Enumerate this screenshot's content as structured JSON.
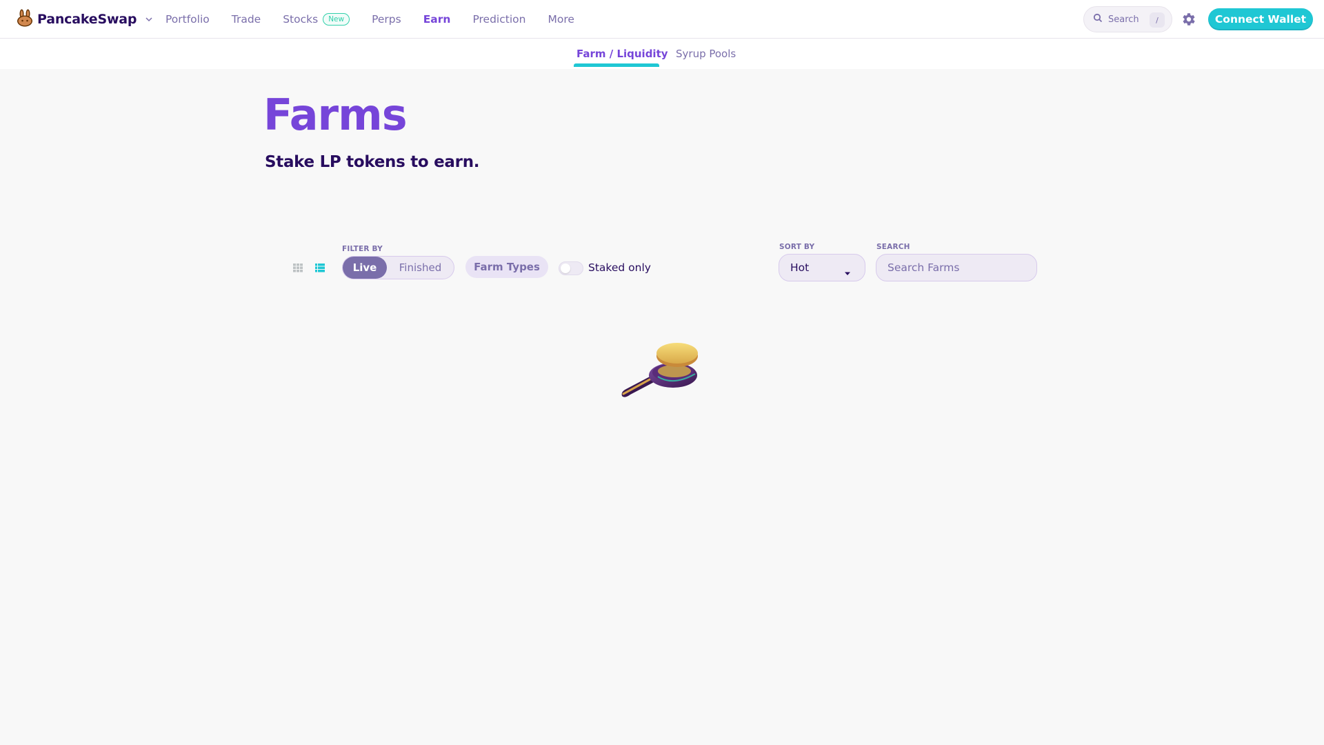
{
  "header": {
    "brand": "PancakeSwap",
    "nav": [
      {
        "label": "Portfolio",
        "active": false
      },
      {
        "label": "Trade",
        "active": false
      },
      {
        "label": "Stocks",
        "badge": "New",
        "active": false
      },
      {
        "label": "Perps",
        "active": false
      },
      {
        "label": "Earn",
        "active": true
      },
      {
        "label": "Prediction",
        "active": false
      },
      {
        "label": "More",
        "active": false
      }
    ],
    "search_label": "Search",
    "search_shortcut": "/",
    "connect_label": "Connect Wallet"
  },
  "subnav": {
    "tabs": [
      {
        "label": "Farm / Liquidity",
        "active": true
      },
      {
        "label": "Syrup Pools",
        "active": false
      }
    ]
  },
  "hero": {
    "title": "Farms",
    "subtitle": "Stake LP tokens to earn."
  },
  "controls": {
    "filter_label": "FILTER BY",
    "filter_options": [
      "Live",
      "Finished"
    ],
    "filter_selected": "Live",
    "farm_types_label": "Farm Types",
    "staked_only_label": "Staked only",
    "staked_only": false,
    "sort_label": "SORT BY",
    "sort_value": "Hot",
    "search_label": "SEARCH",
    "search_placeholder": "Search Farms",
    "view_mode": "list"
  },
  "colors": {
    "primary": "#7645d9",
    "secondary": "#7a6eaa",
    "accent": "#1fc7d4",
    "text": "#280d5f",
    "success": "#31d0aa"
  },
  "icons": [
    "bunny-logo-icon",
    "chevron-down-icon",
    "search-icon",
    "gear-icon",
    "grid-view-icon",
    "list-view-icon",
    "caret-down-icon",
    "frying-pan-loader-icon"
  ]
}
